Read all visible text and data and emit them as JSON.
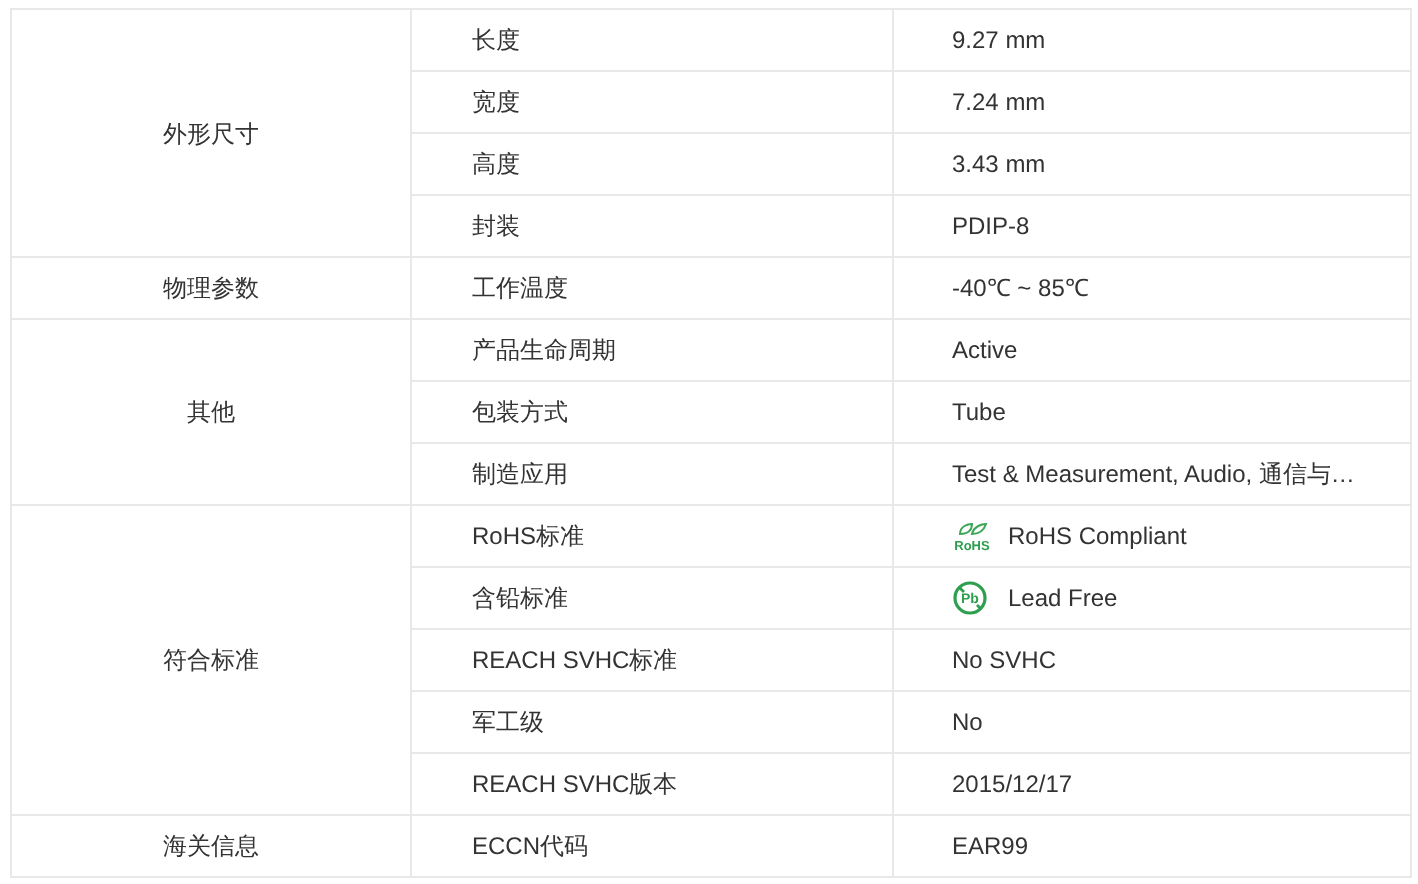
{
  "groups": [
    {
      "category": "外形尺寸",
      "rows": [
        {
          "name": "长度",
          "value": "9.27 mm",
          "kind": "text"
        },
        {
          "name": "宽度",
          "value": "7.24 mm",
          "kind": "text"
        },
        {
          "name": "高度",
          "value": "3.43 mm",
          "kind": "text"
        },
        {
          "name": "封装",
          "value": "PDIP-8",
          "kind": "text"
        }
      ]
    },
    {
      "category": "物理参数",
      "rows": [
        {
          "name": "工作温度",
          "value": "-40℃ ~ 85℃",
          "kind": "text"
        }
      ]
    },
    {
      "category": "其他",
      "rows": [
        {
          "name": "产品生命周期",
          "value": "Active",
          "kind": "text"
        },
        {
          "name": "包装方式",
          "value": "Tube",
          "kind": "text"
        },
        {
          "name": "制造应用",
          "value": "Test & Measurement, Audio, 通信与…",
          "kind": "text"
        }
      ]
    },
    {
      "category": "符合标准",
      "rows": [
        {
          "name": "RoHS标准",
          "value": "RoHS Compliant",
          "kind": "rohs",
          "icon_label": "RoHS"
        },
        {
          "name": "含铅标准",
          "value": "Lead Free",
          "kind": "lead-free",
          "icon_label": "Pb"
        },
        {
          "name": "REACH SVHC标准",
          "value": "No SVHC",
          "kind": "text"
        },
        {
          "name": "军工级",
          "value": "No",
          "kind": "text"
        },
        {
          "name": "REACH SVHC版本",
          "value": "2015/12/17",
          "kind": "text"
        }
      ]
    },
    {
      "category": "海关信息",
      "rows": [
        {
          "name": "ECCN代码",
          "value": "EAR99",
          "kind": "text"
        }
      ]
    }
  ]
}
